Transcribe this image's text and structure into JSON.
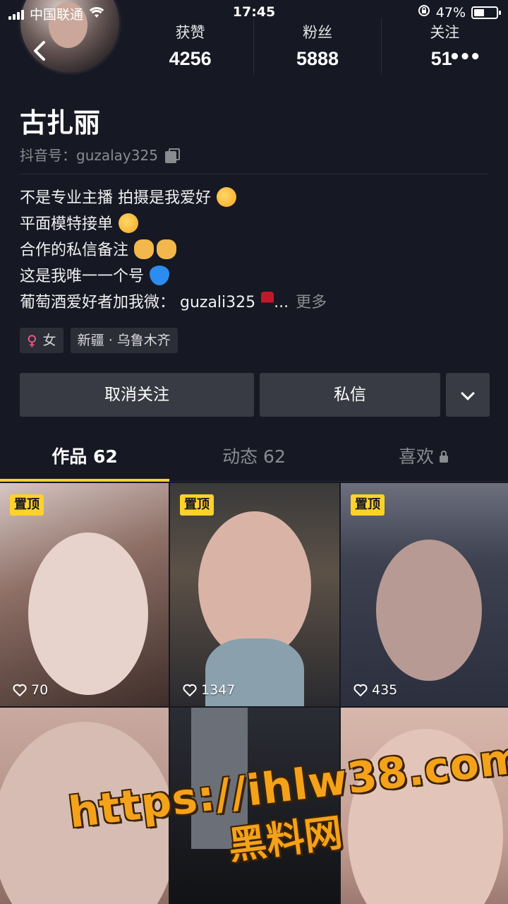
{
  "status_bar": {
    "carrier": "中国联通",
    "time": "17:45",
    "battery_percent": "47%",
    "battery_level": 0.47
  },
  "stats": [
    {
      "label": "获赞",
      "value": "4256"
    },
    {
      "label": "粉丝",
      "value": "5888"
    },
    {
      "label": "关注",
      "value": "51"
    }
  ],
  "profile": {
    "name": "古扎丽",
    "douyin_id": "抖音号：guzalay325",
    "bio": [
      {
        "text": "不是专业主播 拍摄是我爱好",
        "emoji": "smile"
      },
      {
        "text": "平面模特接单",
        "emoji": "smile"
      },
      {
        "text": "合作的私信备注",
        "emoji": "clap"
      },
      {
        "text": " 这是我唯一一个号",
        "emoji": "heart"
      },
      {
        "text": "葡萄酒爱好者加我微： guzali325",
        "emoji": "wine"
      }
    ],
    "bio_ellipsis": "...",
    "more_label": "更多",
    "gender_tag": "女",
    "location_tag": "新疆 · 乌鲁木齐"
  },
  "actions": {
    "unfollow_label": "取消关注",
    "message_label": "私信"
  },
  "tabs": [
    {
      "label": "作品 62",
      "active": true
    },
    {
      "label": "动态 62",
      "active": false
    },
    {
      "label": "喜欢",
      "active": false,
      "locked": true
    }
  ],
  "videos": [
    {
      "pinned": true,
      "pin_label": "置顶",
      "likes": "70"
    },
    {
      "pinned": true,
      "pin_label": "置顶",
      "likes": "1347"
    },
    {
      "pinned": true,
      "pin_label": "置顶",
      "likes": "435"
    },
    {
      "pinned": false,
      "pin_label": "",
      "likes": ""
    },
    {
      "pinned": false,
      "pin_label": "",
      "likes": ""
    },
    {
      "pinned": false,
      "pin_label": "",
      "likes": ""
    }
  ],
  "watermark": {
    "url": "https://ihlw38.com",
    "site": "黑料网"
  },
  "colors": {
    "background": "#161823",
    "accent": "#fdd22c",
    "button": "#393b44",
    "muted_text": "#8a8b91"
  }
}
